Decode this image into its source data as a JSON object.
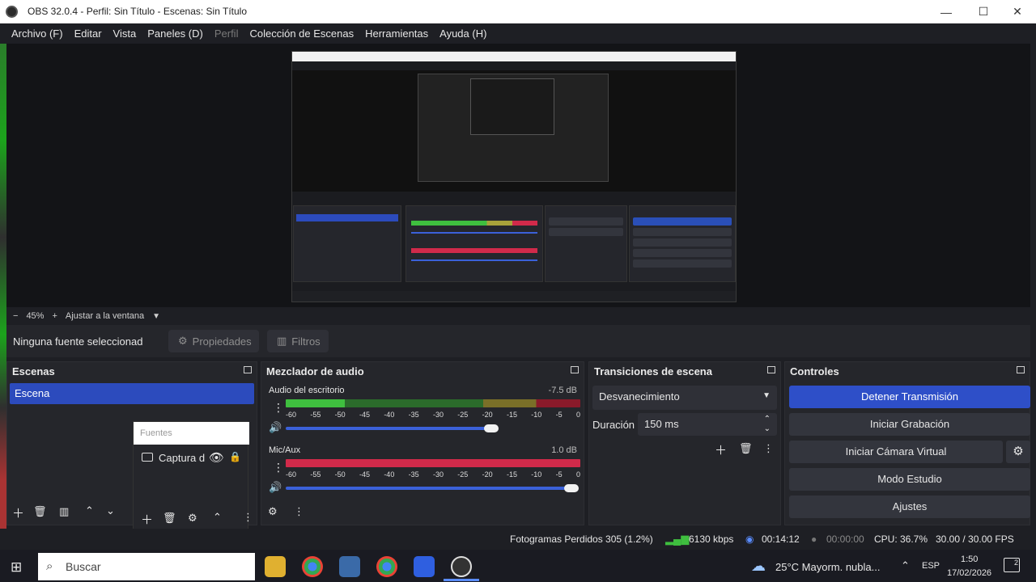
{
  "window": {
    "title": "OBS 32.0.4 - Perfil: Sin Título - Escenas: Sin Título",
    "minimize_glyph": "—",
    "maximize_glyph": "☐",
    "close_glyph": "✕"
  },
  "menu": {
    "archivo": "Archivo (F)",
    "editar": "Editar",
    "vista": "Vista",
    "paneles": "Paneles (D)",
    "perfil": "Perfil",
    "coleccion": "Colección de Escenas",
    "herramientas": "Herramientas",
    "ayuda": "Ayuda (H)"
  },
  "zoom": {
    "minus": "−",
    "value": "45%",
    "plus": "+",
    "fit_label": "Ajustar a la ventana"
  },
  "source_bar": {
    "no_source": "Ninguna fuente seleccionad",
    "properties": "Propiedades",
    "filters": "Filtros"
  },
  "scenes": {
    "header": "Escenas",
    "items": [
      "Escena"
    ]
  },
  "sources": {
    "placeholder": "Fuentes",
    "items": [
      {
        "label": "Captura d"
      }
    ]
  },
  "mixer": {
    "header": "Mezclador de audio",
    "channels": [
      {
        "name": "Audio del escritorio",
        "db": "-7.5 dB",
        "volume": 0.7
      },
      {
        "name": "Mic/Aux",
        "db": "1.0 dB",
        "volume": 1.0
      }
    ],
    "ticks": [
      "-60",
      "-55",
      "-50",
      "-45",
      "-40",
      "-35",
      "-30",
      "-25",
      "-20",
      "-15",
      "-10",
      "-5",
      "0"
    ]
  },
  "transitions": {
    "header": "Transiciones de escena",
    "selected": "Desvanecimiento",
    "duration_label": "Duración",
    "duration_value": "150 ms"
  },
  "controls": {
    "header": "Controles",
    "stop_stream": "Detener Transmisión",
    "start_record": "Iniciar Grabación",
    "virtual_cam": "Iniciar Cámara Virtual",
    "studio_mode": "Modo Estudio",
    "settings": "Ajustes"
  },
  "status": {
    "dropped": "Fotogramas Perdidos 305 (1.2%)",
    "bitrate": "6130 kbps",
    "stream_time": "00:14:12",
    "rec_time": "00:00:00",
    "cpu": "CPU: 36.7%",
    "fps": "30.00 / 30.00 FPS"
  },
  "taskbar": {
    "search_placeholder": "Buscar",
    "weather": "25°C  Mayorm. nubla...",
    "lang": "ESP",
    "time": "1:50",
    "date": "17/02/2026",
    "notif_count": "2"
  },
  "colors": {
    "accent": "#2e4fc8",
    "meter_green": "#3fbf3f",
    "meter_yellow": "#a8a23a",
    "meter_red": "#d12a4a"
  }
}
